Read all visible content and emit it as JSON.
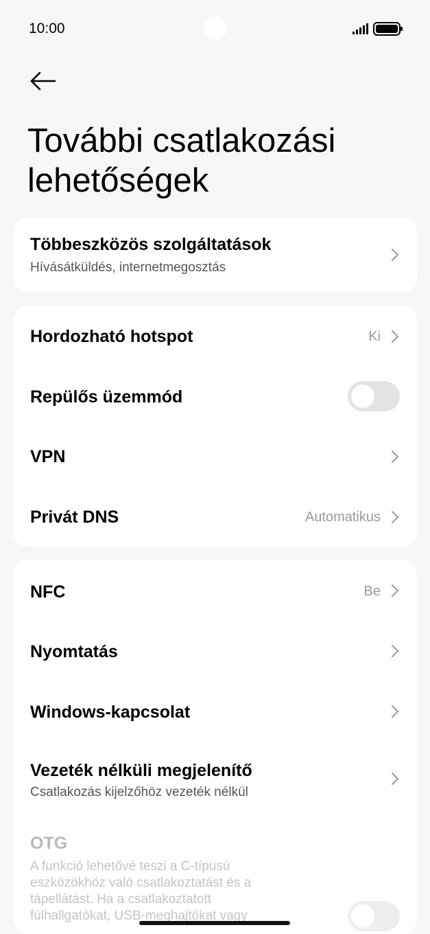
{
  "status_bar": {
    "time": "10:00"
  },
  "page": {
    "title": "További csatlakozási lehetőségek"
  },
  "card1": {
    "multi_device": {
      "label": "Többeszközös szolgáltatások",
      "sub": "Hívásátküldés, internetmegosztás"
    }
  },
  "card2": {
    "hotspot": {
      "label": "Hordozható hotspot",
      "value": "Ki"
    },
    "airplane": {
      "label": "Repülős üzemmód",
      "on": false
    },
    "vpn": {
      "label": "VPN"
    },
    "private_dns": {
      "label": "Privát DNS",
      "value": "Automatikus"
    }
  },
  "card3": {
    "nfc": {
      "label": "NFC",
      "value": "Be"
    },
    "printing": {
      "label": "Nyomtatás"
    },
    "windows": {
      "label": "Windows-kapcsolat"
    },
    "wireless_display": {
      "label": "Vezeték nélküli megjelenítő",
      "sub": "Csatlakozás kijelzőhöz vezeték nélkül"
    }
  },
  "otg": {
    "label": "OTG",
    "description": "A funkció lehetővé teszi a C-típusú eszközökhöz való csatlakoztatást és a tápellátást. Ha a csatlakoztatott fülhallgatókat, USB-meghajtókat vagy",
    "on": false
  },
  "icons": {
    "back": "back-arrow-icon",
    "chevron": "chevron-right-icon",
    "signal": "signal-icon",
    "battery": "battery-icon"
  }
}
